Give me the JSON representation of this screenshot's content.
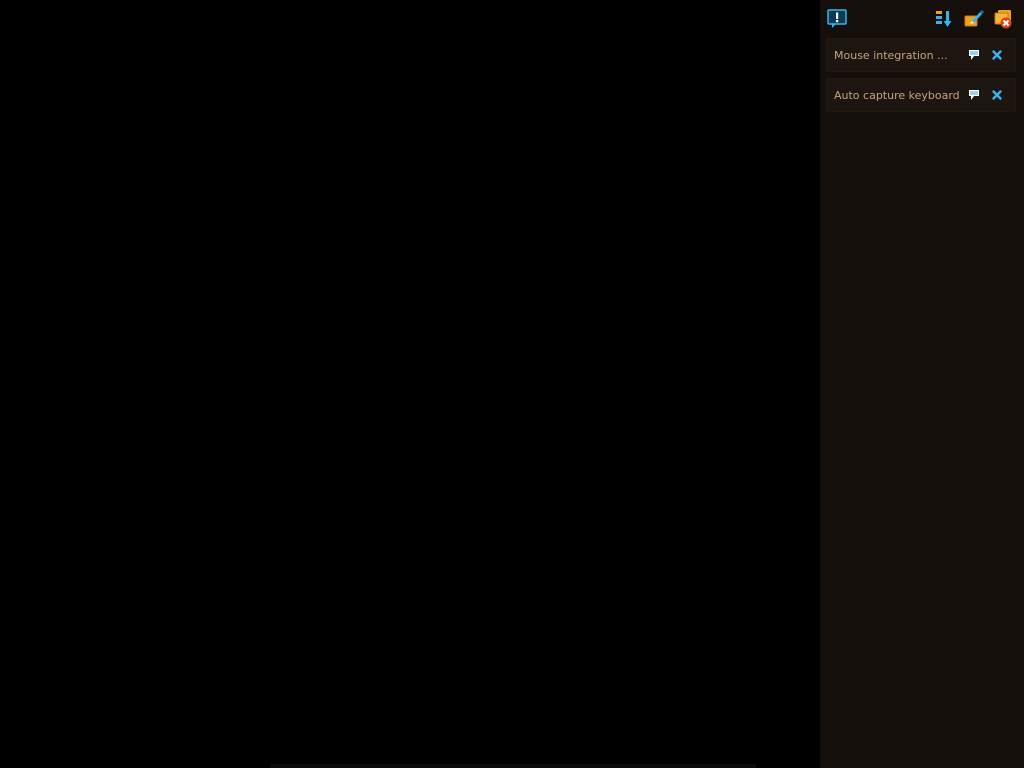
{
  "notification_panel": {
    "toolbar": {
      "messages_icon": "message-exclamation-icon",
      "sort_icon": "sort-order-icon",
      "pin_all_icon": "pin-icon",
      "dismiss_all_icon": "dismiss-all-icon"
    },
    "notices": [
      {
        "text": "Mouse integration ...",
        "pin_icon": "pin-icon",
        "close_icon": "close-icon"
      },
      {
        "text": "Auto capture keyboard ...",
        "pin_icon": "pin-icon",
        "close_icon": "close-icon"
      }
    ]
  },
  "colors": {
    "display_background": "#000000",
    "panel_background": "#140f0b",
    "notice_background": "#1d1610",
    "notice_text": "#c2a47c",
    "accent_blue": "#38b4ec",
    "accent_orange": "#f0a020",
    "accent_red": "#d8401c"
  }
}
